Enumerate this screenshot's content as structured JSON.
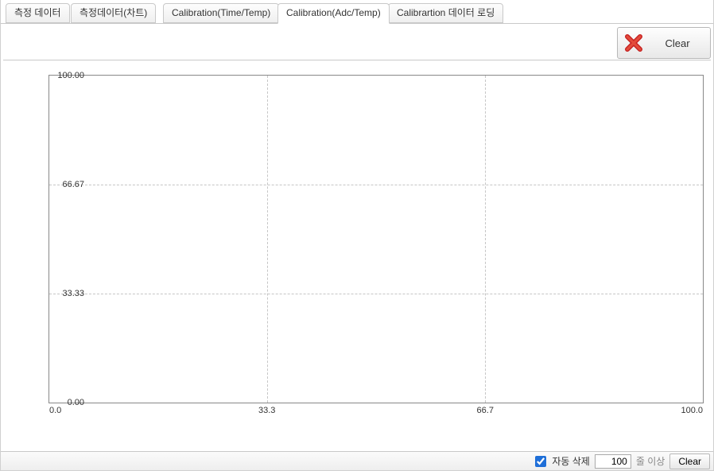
{
  "tabs": [
    {
      "label": "측정 데이터"
    },
    {
      "label": "측정데이터(차트)"
    },
    {
      "label": "Calibration(Time/Temp)"
    },
    {
      "label": "Calibration(Adc/Temp)"
    },
    {
      "label": "Calibrartion 데이터 로딩"
    }
  ],
  "active_tab_index": 3,
  "toolbar": {
    "clear_label": "Clear"
  },
  "statusbar": {
    "auto_delete_label": "자동 삭제",
    "auto_delete_checked": true,
    "threshold_value": "100",
    "threshold_suffix": "줄 이상",
    "clear_label": "Clear"
  },
  "chart_data": {
    "type": "line",
    "series": [],
    "x": [],
    "xlabel": "",
    "ylabel": "",
    "xlim": [
      0.0,
      100.0
    ],
    "ylim": [
      0.0,
      100.0
    ],
    "xticks": [
      {
        "value": 0.0,
        "label": "0.0"
      },
      {
        "value": 33.3,
        "label": "33.3"
      },
      {
        "value": 66.7,
        "label": "66.7"
      },
      {
        "value": 100.0,
        "label": "100.0"
      }
    ],
    "yticks": [
      {
        "value": 0.0,
        "label": "0.00"
      },
      {
        "value": 33.33,
        "label": "33.33"
      },
      {
        "value": 66.67,
        "label": "66.67"
      },
      {
        "value": 100.0,
        "label": "100.00"
      }
    ],
    "grid": true
  }
}
